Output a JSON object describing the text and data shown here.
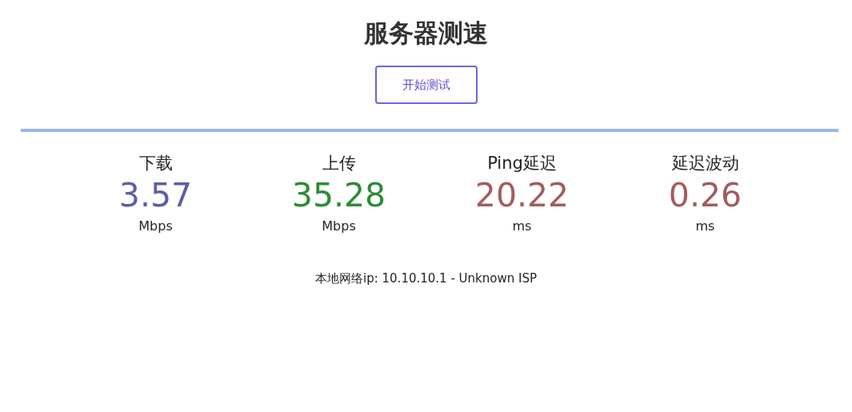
{
  "title": "服务器测速",
  "start_button": "开始测试",
  "metrics": [
    {
      "label": "下载",
      "value": "3.57",
      "unit": "Mbps",
      "color": "#5c5ea8"
    },
    {
      "label": "上传",
      "value": "35.28",
      "unit": "Mbps",
      "color": "#2e8b34"
    },
    {
      "label": "Ping延迟",
      "value": "20.22",
      "unit": "ms",
      "color": "#a45c5c"
    },
    {
      "label": "延迟波动",
      "value": "0.26",
      "unit": "ms",
      "color": "#a45c5c"
    }
  ],
  "ip_info": "本地网络ip: 10.10.10.1 - Unknown ISP"
}
